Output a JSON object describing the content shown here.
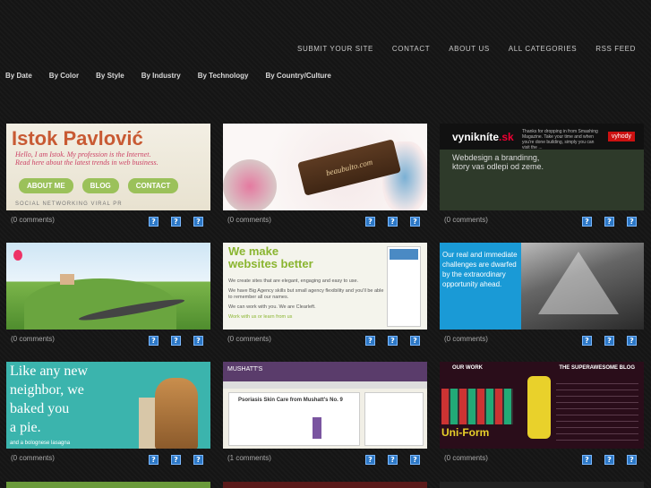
{
  "top_nav": [
    "SUBMIT YOUR SITE",
    "CONTACT",
    "ABOUT US",
    "ALL CATEGORIES",
    "RSS FEED"
  ],
  "filters": [
    "By Date",
    "By Color",
    "By Style",
    "By Industry",
    "By Technology",
    "By Country/Culture"
  ],
  "cards": [
    {
      "comments": "(0 comments)"
    },
    {
      "comments": "(0 comments)"
    },
    {
      "comments": "(0 comments)"
    },
    {
      "comments": "(0 comments)"
    },
    {
      "comments": "(0 comments)"
    },
    {
      "comments": "(0 comments)"
    },
    {
      "comments": "(0 comments)"
    },
    {
      "comments": "(1 comments)"
    },
    {
      "comments": "(0 comments)"
    }
  ],
  "thumbs": {
    "t1": {
      "title": "Istok Pavlović",
      "sub1": "Hello, I am Istok. My profession is the Internet.",
      "sub2": "Read here about the latest trends in web business.",
      "pills": [
        "ABOUT ME",
        "BLOG",
        "CONTACT"
      ],
      "foot": "SOCIAL NETWORKING  VIRAL PR"
    },
    "t2": {
      "tag": "beaubulto.com"
    },
    "t3": {
      "logo": "vynikníte",
      "logo_tld": ".sk",
      "blurb": "Thanks for dropping in from Smashing Magazine. Take your time and when you're done building, simply you can visit the ...",
      "button": "vyhody",
      "head1": "Webdesign a brandinng,",
      "head2": "ktory vas odlepi od zeme."
    },
    "t5": {
      "h1": "We make",
      "h2": "websites better",
      "p1": "We create sites that are elegant, engaging and easy to use.",
      "p2": "We have Big Agency skills but small agency flexibility and you'll be able to remember all our names.",
      "p3": "We can work with you. We are Clearleft.",
      "p4": "Work with us or learn from us"
    },
    "t6": {
      "text": "Our real and immediate challenges are dwarfed by the extraordinary opportunity ahead."
    },
    "t7": {
      "l1": "Like any new",
      "l2": "neighbor, we",
      "l3": "baked you",
      "l4": "a pie.",
      "small": "and a bolognese lasagna"
    },
    "t8": {
      "brand": "MUSHATT'S",
      "headline": "Psoriasis Skin Care from Mushatt's No. 9"
    },
    "t9": {
      "hd1": "OUR WORK",
      "hd2": "THE SUPERAWESOME BLOG",
      "brand": "Uni-Form"
    }
  },
  "icon_label": "?"
}
